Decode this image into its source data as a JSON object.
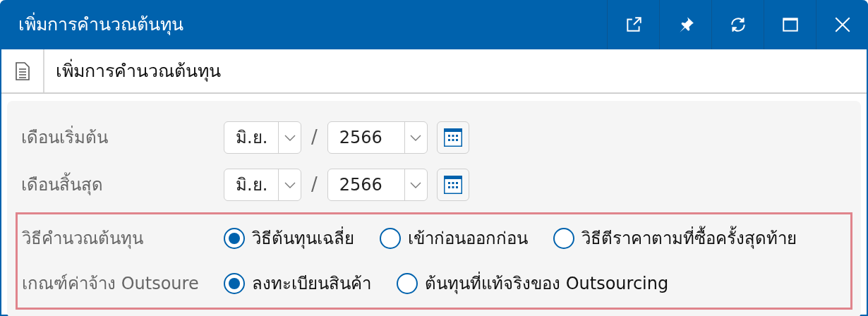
{
  "window": {
    "title": "เพิ่มการคำนวณต้นทุน",
    "buttons": [
      {
        "kind": "popout"
      },
      {
        "kind": "pin"
      },
      {
        "kind": "refresh"
      },
      {
        "kind": "maximize"
      },
      {
        "kind": "close"
      }
    ]
  },
  "header": {
    "title": "เพิ่มการคำนวณต้นทุน"
  },
  "date_rows": [
    {
      "label": "เดือนเริ่มต้น",
      "month": "มิ.ย.",
      "separator": "/",
      "year": "2566"
    },
    {
      "label": "เดือนสิ้นสุด",
      "month": "มิ.ย.",
      "separator": "/",
      "year": "2566"
    }
  ],
  "radio_groups": [
    {
      "label": "วิธีคำนวณต้นทุน",
      "options": [
        {
          "label": "วิธีต้นทุนเฉลี่ย",
          "selected": true
        },
        {
          "label": "เข้าก่อนออกก่อน",
          "selected": false
        },
        {
          "label": "วิธีตีราคาตามที่ซื้อครั้งสุดท้าย",
          "selected": false
        }
      ]
    },
    {
      "label": "เกณฑ์ค่าจ้าง Outsoure",
      "options": [
        {
          "label": "ลงทะเบียนสินค้า",
          "selected": true
        },
        {
          "label": "ต้นทุนที่แท้จริงของ Outsourcing",
          "selected": false
        }
      ]
    }
  ]
}
